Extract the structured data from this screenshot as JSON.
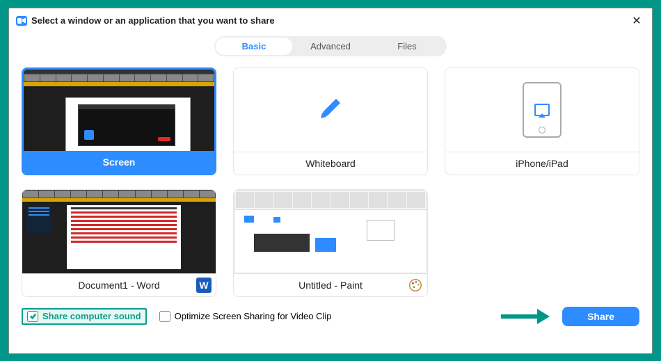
{
  "dialog": {
    "title": "Select a window or an application that you want to share"
  },
  "tabs": {
    "basic": "Basic",
    "advanced": "Advanced",
    "files": "Files"
  },
  "options": {
    "screen": "Screen",
    "whiteboard": "Whiteboard",
    "iphone": "iPhone/iPad",
    "word": "Document1 - Word",
    "paint": "Untitled - Paint"
  },
  "footer": {
    "share_sound": "Share computer sound",
    "optimize": "Optimize Screen Sharing for Video Clip",
    "share_btn": "Share"
  }
}
